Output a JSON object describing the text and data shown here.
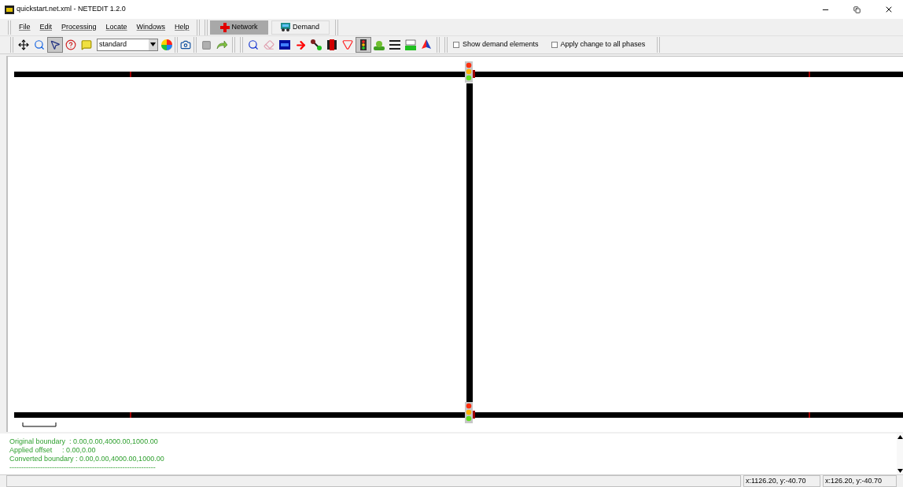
{
  "window": {
    "title": "quickstart.net.xml - NETEDIT 1.2.0"
  },
  "menu": [
    "File",
    "Edit",
    "Processing",
    "Locate",
    "Windows",
    "Help"
  ],
  "modes": [
    {
      "kind": "network",
      "label": "Network",
      "selected": true
    },
    {
      "kind": "demand",
      "label": "Demand",
      "selected": false
    }
  ],
  "view_tools": [
    {
      "kind": "move",
      "selected": false
    },
    {
      "kind": "zoom",
      "selected": false
    },
    {
      "kind": "select",
      "selected": true
    },
    {
      "kind": "inspect",
      "selected": false
    },
    {
      "kind": "tooltip",
      "selected": false
    }
  ],
  "scheme": {
    "value": "standard"
  },
  "edit_tools": [
    {
      "kind": "inspect-zoom",
      "selected": false
    },
    {
      "kind": "erase",
      "selected": false
    },
    {
      "kind": "select-box",
      "selected": false
    },
    {
      "kind": "move-arrow",
      "selected": false
    },
    {
      "kind": "connect",
      "selected": false
    },
    {
      "kind": "junction",
      "selected": false
    },
    {
      "kind": "prohibit",
      "selected": false
    },
    {
      "kind": "traffic-light",
      "selected": true
    },
    {
      "kind": "additional",
      "selected": false
    },
    {
      "kind": "crossing",
      "selected": false
    },
    {
      "kind": "taz",
      "selected": false
    },
    {
      "kind": "shape",
      "selected": false
    }
  ],
  "options": [
    {
      "label": "Show demand elements",
      "checked": false
    },
    {
      "label": "Apply change to all phases",
      "checked": false
    }
  ],
  "log": [
    "Original boundary  : 0.00,0.00,4000.00,1000.00",
    "Applied offset     : 0.00,0.00",
    "Converted boundary : 0.00,0.00,4000.00,1000.00",
    "--------------------------------------------------------------"
  ],
  "status_bar": {
    "coordinates": "x:1126.20, y:-40.70",
    "offset_coordinates": "x:126.20, y:-40.70"
  }
}
